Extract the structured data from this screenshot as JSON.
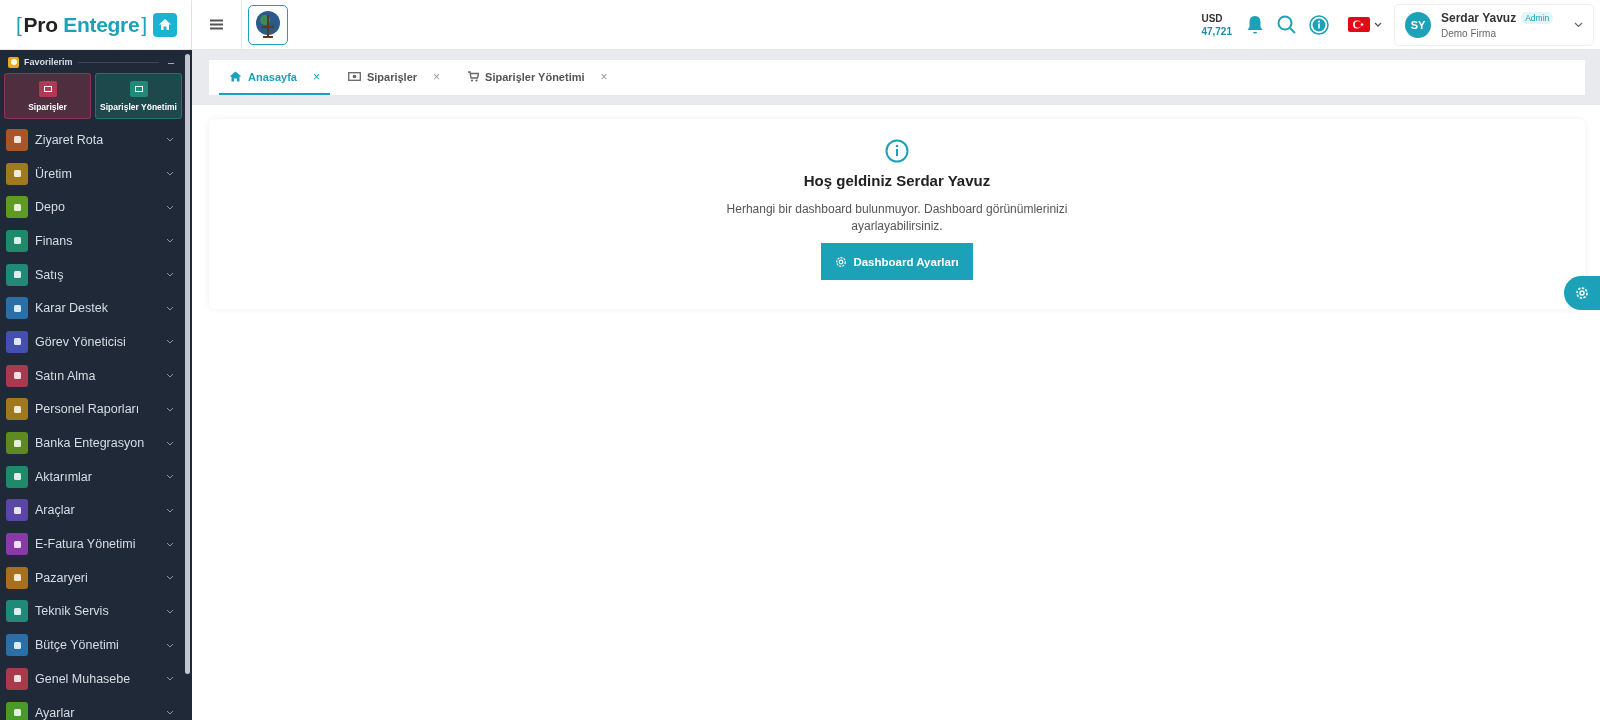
{
  "brand": {
    "open": "[",
    "name_1": "Pro",
    "name_2": "Entegre",
    "close": "]"
  },
  "topbar": {
    "currency": "USD",
    "rate": "47,721",
    "user": {
      "initials": "SY",
      "name": "Serdar Yavuz",
      "role": "Admin",
      "company": "Demo Firma"
    }
  },
  "favorites": {
    "title": "Favorilerim",
    "collapse": "–",
    "items": [
      {
        "label": "Siparişler",
        "color": "#b03a55"
      },
      {
        "label": "Siparişler Yönetimi",
        "color": "#1f8a78"
      }
    ]
  },
  "menu": [
    {
      "label": "Ziyaret Rota",
      "color": "#a8552a"
    },
    {
      "label": "Üretim",
      "color": "#a07a1e"
    },
    {
      "label": "Depo",
      "color": "#5f9a22"
    },
    {
      "label": "Finans",
      "color": "#1f8a6a"
    },
    {
      "label": "Satış",
      "color": "#1f8a78"
    },
    {
      "label": "Karar Destek",
      "color": "#2a6fa8"
    },
    {
      "label": "Görev Yöneticisi",
      "color": "#4450b0"
    },
    {
      "label": "Satın Alma",
      "color": "#a83a50"
    },
    {
      "label": "Personel Raporları",
      "color": "#a0781e"
    },
    {
      "label": "Banka Entegrasyon",
      "color": "#5f8a22"
    },
    {
      "label": "Aktarımlar",
      "color": "#1f8a6a"
    },
    {
      "label": "Araçlar",
      "color": "#5a45a8"
    },
    {
      "label": "E-Fatura Yönetimi",
      "color": "#8a3aa8"
    },
    {
      "label": "Pazaryeri",
      "color": "#a8701e"
    },
    {
      "label": "Teknik Servis",
      "color": "#1f8a78"
    },
    {
      "label": "Bütçe Yönetimi",
      "color": "#2a6fa8"
    },
    {
      "label": "Genel Muhasebe",
      "color": "#a83a4a"
    },
    {
      "label": "Ayarlar",
      "color": "#4a9a2a"
    }
  ],
  "tabs": [
    {
      "label": "Anasayfa",
      "kind": "home",
      "selected": true,
      "close": "×"
    },
    {
      "label": "Siparişler",
      "kind": "cash",
      "selected": false,
      "close": "×"
    },
    {
      "label": "Siparişler Yönetimi",
      "kind": "cart",
      "selected": false,
      "close": "×"
    }
  ],
  "welcome": {
    "title": "Hoş geldiniz Serdar Yavuz",
    "message": "Herhangi bir dashboard bulunmuyor. Dashboard görünümlerinizi ayarlayabilirsiniz.",
    "button": "Dashboard Ayarları"
  }
}
